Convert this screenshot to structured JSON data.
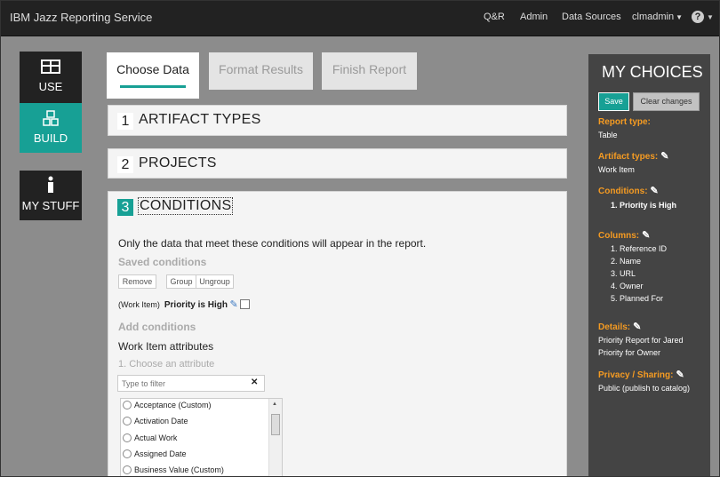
{
  "topbar": {
    "title": "IBM Jazz Reporting Service",
    "nav": [
      "Q&R",
      "Admin",
      "Data Sources",
      "clmadmin"
    ],
    "help_label": "?"
  },
  "sidebar": {
    "items": [
      {
        "label": "USE",
        "icon": "table-icon"
      },
      {
        "label": "BUILD",
        "icon": "blocks-icon"
      },
      {
        "label": "MY STUFF",
        "icon": "person-icon"
      }
    ]
  },
  "tabs": [
    {
      "label": "Choose Data",
      "active": true
    },
    {
      "label": "Format Results",
      "active": false
    },
    {
      "label": "Finish Report",
      "active": false
    }
  ],
  "panels": [
    {
      "number": "1",
      "title": "ARTIFACT TYPES"
    },
    {
      "number": "2",
      "title": "PROJECTS"
    },
    {
      "number": "3",
      "title": "CONDITIONS"
    }
  ],
  "conditions": {
    "intro": "Only the data that meet these conditions will appear in the report.",
    "saved_heading": "Saved conditions",
    "buttons": {
      "remove": "Remove",
      "group": "Group",
      "ungroup": "Ungroup"
    },
    "saved_item": {
      "prefix": "(Work Item)",
      "text": "Priority is High"
    },
    "add_heading": "Add conditions",
    "attributes_heading": "Work Item attributes",
    "choose_label": "1. Choose an attribute",
    "filter_placeholder": "Type to filter",
    "attributes": [
      "Acceptance (Custom)",
      "Activation Date",
      "Actual Work",
      "Assigned Date",
      "Business Value (Custom)"
    ]
  },
  "choices": {
    "title": "MY CHOICES",
    "save": "Save",
    "clear": "Clear changes",
    "report_type_label": "Report type:",
    "report_type": "Table",
    "artifact_types_label": "Artifact types:",
    "artifact_types": "Work Item",
    "conditions_label": "Conditions:",
    "conditions": [
      "1.  Priority is High"
    ],
    "columns_label": "Columns:",
    "columns": [
      "1.  Reference ID",
      "2.  Name",
      "3.  URL",
      "4.  Owner",
      "5.  Planned For"
    ],
    "details_label": "Details:",
    "details": [
      "Priority Report for Jared",
      "Priority for Owner"
    ],
    "privacy_label": "Privacy / Sharing:",
    "privacy": "Public (publish to catalog)"
  },
  "colors": {
    "accent": "#17a095",
    "topbar": "#222222",
    "choices_bg": "#444444",
    "label_orange": "#f59b22"
  }
}
